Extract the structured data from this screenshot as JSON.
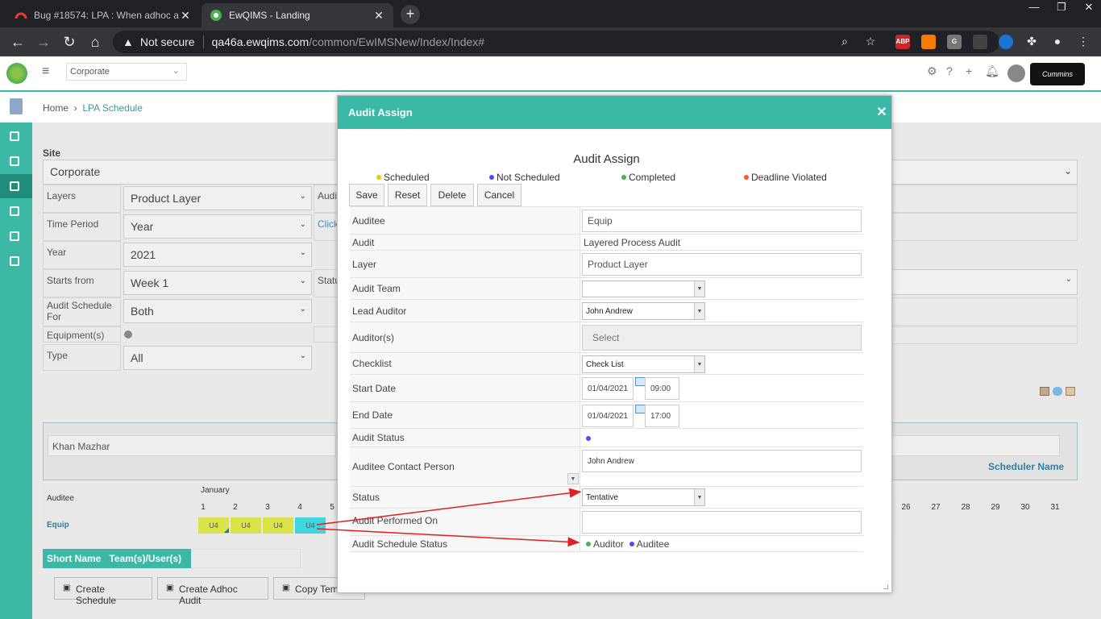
{
  "browser": {
    "tabs": [
      {
        "title": "Bug #18574: LPA : When adhoc a",
        "active": false
      },
      {
        "title": "EwQIMS - Landing",
        "active": true
      }
    ],
    "address": {
      "security": "Not secure",
      "host": "qa46a.ewqims.com",
      "path": "/common/EwIMSNew/Index/Index#"
    },
    "extensions": [
      "ABP",
      "G"
    ]
  },
  "app": {
    "org_select": "Corporate",
    "breadcrumb": {
      "home": "Home",
      "current": "LPA Schedule"
    }
  },
  "filters": {
    "site_label": "Site",
    "site_value": "Corporate",
    "rows": [
      {
        "label": "Layers",
        "value": "Product Layer"
      },
      {
        "label": "Time Period",
        "value": "Year"
      },
      {
        "label": "Year",
        "value": "2021"
      },
      {
        "label": "Starts from",
        "value": "Week 1"
      },
      {
        "label": "Audit Schedule For",
        "value": "Both"
      },
      {
        "label": "Equipment(s)",
        "value": ""
      },
      {
        "label": "Type",
        "value": "All"
      }
    ],
    "partial_labels": [
      "Audi",
      "Click",
      "Statu"
    ]
  },
  "scheduler": {
    "user": "Khan Mazhar",
    "scheduler_name_label": "Scheduler Name",
    "auditee_col": "Auditee",
    "month": "January",
    "days_left": [
      "1",
      "2",
      "3",
      "4",
      "5"
    ],
    "days_right": [
      "26",
      "27",
      "28",
      "29",
      "30",
      "31"
    ],
    "row_name": "Equip",
    "cells": [
      "U4",
      "U4",
      "U4",
      "U4"
    ],
    "legend_header": [
      "Short Name",
      "Team(s)/User(s)"
    ]
  },
  "bottom_buttons": [
    "Create Schedule",
    "Create Adhoc Audit",
    "Copy Tem"
  ],
  "modal": {
    "header": "Audit Assign",
    "title": "Audit Assign",
    "legend": [
      {
        "label": "Scheduled",
        "color": "#f0c808"
      },
      {
        "label": "Not Scheduled",
        "color": "#4b4bff"
      },
      {
        "label": "Completed",
        "color": "#4caf50"
      },
      {
        "label": "Deadline Violated",
        "color": "#ff5722"
      }
    ],
    "buttons": [
      "Save",
      "Reset",
      "Delete",
      "Cancel"
    ],
    "fields": {
      "auditee": {
        "label": "Auditee",
        "value": "Equip"
      },
      "audit": {
        "label": "Audit",
        "value": "Layered Process Audit"
      },
      "layer": {
        "label": "Layer",
        "value": "Product Layer"
      },
      "audit_team": {
        "label": "Audit Team",
        "value": ""
      },
      "lead_auditor": {
        "label": "Lead Auditor",
        "value": "John Andrew"
      },
      "auditors": {
        "label": "Auditor(s)",
        "placeholder": "Select"
      },
      "checklist": {
        "label": "Checklist",
        "value": "Check List"
      },
      "start_date": {
        "label": "Start Date",
        "date": "01/04/2021",
        "time": "09:00"
      },
      "end_date": {
        "label": "End Date",
        "date": "01/04/2021",
        "time": "17:00"
      },
      "audit_status": {
        "label": "Audit Status"
      },
      "contact": {
        "label": "Auditee Contact Person",
        "value": "John Andrew"
      },
      "status": {
        "label": "Status",
        "value": "Tentative"
      },
      "performed_on": {
        "label": "Audit Performed On",
        "value": ""
      },
      "schedule_status": {
        "label": "Audit Schedule Status",
        "auditor": "Auditor",
        "auditee": "Auditee"
      }
    }
  },
  "colors": {
    "accent": "#3bb8a6",
    "arrow": "#e02020",
    "cell_yellow": "#d9e44a",
    "cell_cyan": "#3fd6e0"
  }
}
